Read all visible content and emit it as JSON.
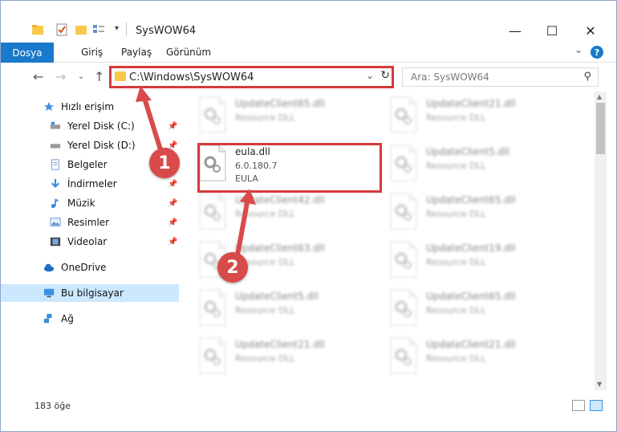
{
  "window": {
    "title": "SysWOW64"
  },
  "ribbon": {
    "tabs": [
      "Dosya",
      "Giriş",
      "Paylaş",
      "Görünüm"
    ]
  },
  "nav": {
    "address": "C:\\Windows\\SysWOW64",
    "search_placeholder": "Ara: SysWOW64"
  },
  "sidebar": {
    "items": [
      {
        "label": "Hızlı erişim",
        "icon": "star-icon"
      },
      {
        "label": "Yerel Disk (C:)",
        "icon": "drive-icon"
      },
      {
        "label": "Yerel Disk (D:)",
        "icon": "drive-icon"
      },
      {
        "label": "Belgeler",
        "icon": "documents-icon"
      },
      {
        "label": "İndirmeler",
        "icon": "download-icon"
      },
      {
        "label": "Müzik",
        "icon": "music-icon"
      },
      {
        "label": "Resimler",
        "icon": "pictures-icon"
      },
      {
        "label": "Videolar",
        "icon": "videos-icon"
      },
      {
        "label": "OneDrive",
        "icon": "cloud-icon"
      },
      {
        "label": "Bu bilgisayar",
        "icon": "computer-icon"
      },
      {
        "label": "Ağ",
        "icon": "network-icon"
      }
    ]
  },
  "files": [
    {
      "name": "UpdateClient65.dll",
      "desc": "Resource DLL",
      "sub": ""
    },
    {
      "name": "UpdateClient21.dll",
      "desc": "Resource DLL",
      "sub": ""
    },
    {
      "name": "eula.dll",
      "desc": "6.0.180.7",
      "sub": "EULA"
    },
    {
      "name": "UpdateClient5.dll",
      "desc": "Resource DLL",
      "sub": ""
    },
    {
      "name": "UpdateClient42.dll",
      "desc": "Resource DLL",
      "sub": ""
    },
    {
      "name": "UpdateClient65.dll",
      "desc": "Resource DLL",
      "sub": ""
    },
    {
      "name": "UpdateClient63.dll",
      "desc": "Resource DLL",
      "sub": ""
    },
    {
      "name": "UpdateClient19.dll",
      "desc": "Resource DLL",
      "sub": ""
    },
    {
      "name": "UpdateClient5.dll",
      "desc": "Resource DLL",
      "sub": ""
    },
    {
      "name": "UpdateClient65.dll",
      "desc": "Resource DLL",
      "sub": ""
    },
    {
      "name": "UpdateClient21.dll",
      "desc": "Resource DLL",
      "sub": ""
    },
    {
      "name": "UpdateClient21.dll",
      "desc": "Resource DLL",
      "sub": ""
    }
  ],
  "status": {
    "count": "183 öğe"
  },
  "annotations": {
    "badge1": "1",
    "badge2": "2",
    "color": "#d63a3a"
  }
}
